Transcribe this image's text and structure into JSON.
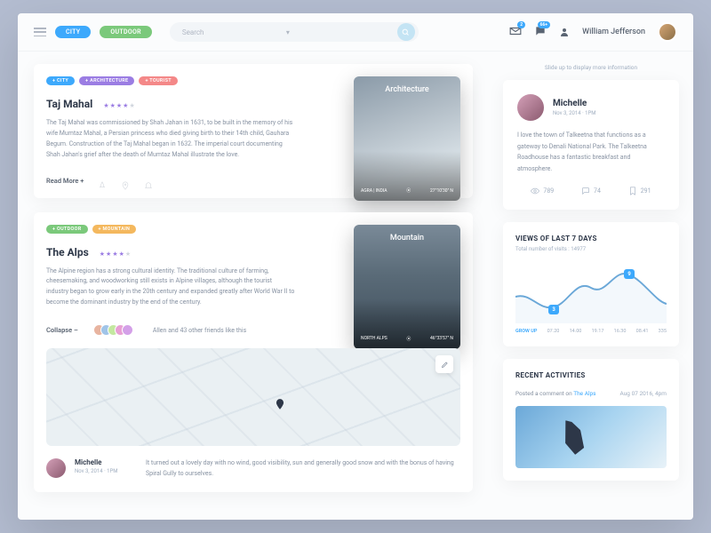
{
  "header": {
    "pills": {
      "city": "CITY",
      "outdoor": "OUTDOOR"
    },
    "search_placeholder": "Search",
    "mail_badge": "2",
    "chat_badge": "66+",
    "username": "William Jefferson"
  },
  "feed": [
    {
      "tags": [
        "+ CITY",
        "+ ARCHITECTURE",
        "+ TOURIST"
      ],
      "title": "Taj Mahal",
      "desc": "The Taj Mahal was commissioned by Shah Jahan in 1631, to be built in the memory of his wife Mumtaz Mahal, a Persian princess who died giving birth to their 14th child, Gauhara Begum. Construction of the Taj Mahal began in 1632. The imperial court documenting Shah Jahan's grief after the death of Mumtaz Mahal illustrate the love.",
      "readmore": "Read More +",
      "thumb_label": "Architecture",
      "thumb_city": "AGRA | INDIA",
      "thumb_coord": "27°10'30\" N"
    },
    {
      "tags": [
        "+ OUTDOOR",
        "+ MOUNTAIN"
      ],
      "title": "The Alps",
      "desc": "The Alpine region has a strong cultural identity. The traditional culture of farming, cheesemaking, and woodworking still exists in Alpine villages, although the tourist industry began to grow early in the 20th century and expanded greatly after World War II to become the dominant industry by the end of the century.",
      "collapse": "Collapse –",
      "likes": "Allen and 43 other friends like this",
      "thumb_label": "Mountain",
      "thumb_city": "NORTH ALPS",
      "thumb_coord": "46°33'57\" N",
      "comment": {
        "name": "Michelle",
        "date": "Nov 3, 2014 · 1PM",
        "text": "It turned out a lovely day with no wind, good visibility, sun and generally good snow and with the bonus of having Spiral Gully to ourselves."
      }
    }
  ],
  "side": {
    "hint": "Slide up to display more information",
    "profile": {
      "name": "Michelle",
      "date": "Nov 3, 2014 · 1PM",
      "bio": "I love the town of Talkeetna that functions as a gateway to Denali National Park. The Talkeetna Roadhouse has a fantastic breakfast and atmosphere.",
      "views": "789",
      "comments": "74",
      "bookmarks": "291"
    },
    "views_panel": {
      "title": "VIEWS OF LAST 7 DAYS",
      "subtitle": "Total number of visits : 14977",
      "labels": [
        "GROW UP",
        "07.20",
        "14.00",
        "19.17",
        "16.30",
        "08.41",
        "335"
      ],
      "points": {
        "low": "3",
        "high": "9"
      }
    },
    "activities": {
      "title": "RECENT ACTIVITIES",
      "text": "Posted a comment on ",
      "link": "The Alps",
      "date": "Aug 07 2016, 4pm"
    }
  },
  "chart_data": {
    "type": "line",
    "title": "VIEWS OF LAST 7 DAYS",
    "subtitle": "Total number of visits : 14977",
    "x": [
      0,
      1,
      2,
      3,
      4,
      5,
      6
    ],
    "values": [
      5,
      3,
      8,
      6,
      9,
      5,
      4
    ],
    "annotations": [
      {
        "x": 1,
        "y": 3,
        "label": "3"
      },
      {
        "x": 4,
        "y": 9,
        "label": "9"
      }
    ],
    "ylim": [
      0,
      10
    ],
    "x_tick_labels": [
      "GROW UP",
      "07.20",
      "14.00",
      "19.17",
      "16.30",
      "08.41",
      "335"
    ]
  }
}
